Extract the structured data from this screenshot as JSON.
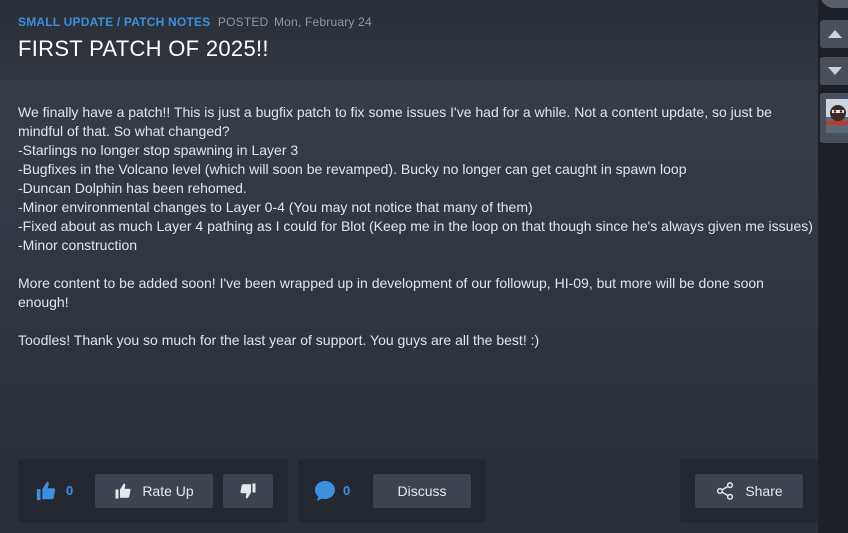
{
  "post": {
    "category": "SMALL UPDATE / PATCH NOTES",
    "posted_label": "POSTED",
    "date": "Mon, February 24",
    "title": "FIRST PATCH OF 2025!!",
    "paragraph1_lines": [
      "We finally have a patch!! This is just a bugfix patch to fix some issues I've had for a while. Not a content update, so just be mindful of that. So what changed?",
      "-Starlings no longer stop spawning in Layer 3",
      "-Bugfixes in the Volcano level (which will soon be revamped). Bucky no longer can get caught in spawn loop",
      "-Duncan Dolphin has been rehomed.",
      "-Minor environmental changes to Layer 0-4 (You may not notice that many of them)",
      "-Fixed about as much Layer 4 pathing as I could for Blot (Keep me in the loop on that though since he's always given me issues)",
      "-Minor construction"
    ],
    "paragraph2": "More content to be added soon! I've been wrapped up in development of our followup, HI-09, but more will be done soon enough!",
    "paragraph3": "Toodles! Thank you so much for the last year of support. You guys are all the best! :)"
  },
  "footer": {
    "rate_count": "0",
    "rate_up_label": "Rate Up",
    "comment_count": "0",
    "discuss_label": "Discuss",
    "share_label": "Share"
  },
  "icons": {
    "thumbs_up": "thumbs-up-icon",
    "thumbs_down": "thumbs-down-icon",
    "comment": "comment-bubble-icon",
    "share": "share-icon",
    "scroll_up": "triangle-up-icon",
    "scroll_down": "triangle-down-icon"
  },
  "colors": {
    "accent": "#3d8fe0",
    "panel": "#333944",
    "button": "#3d4450",
    "footer_box": "#242830"
  }
}
